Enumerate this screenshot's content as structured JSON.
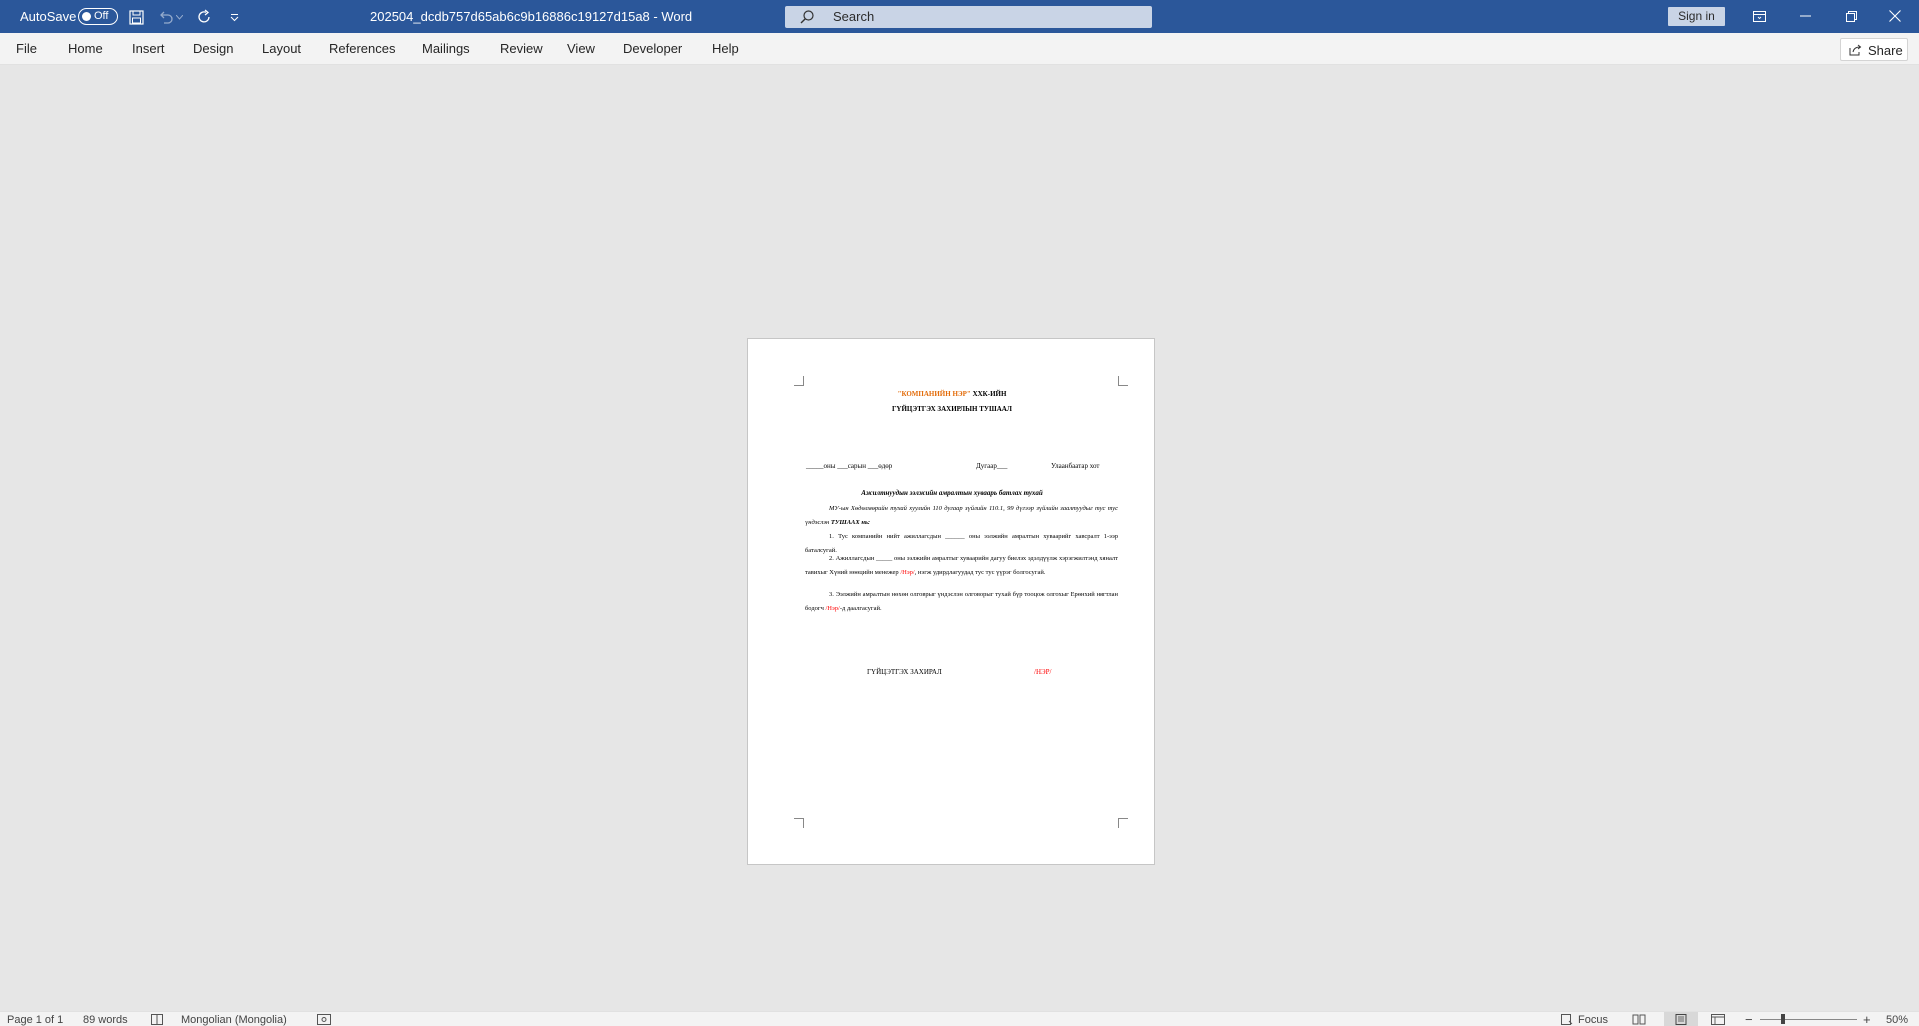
{
  "titlebar": {
    "autosave_label": "AutoSave",
    "autosave_state": "Off",
    "document_title": "202504_dcdb757d65ab6c9b16886c19127d15a8  -  Word",
    "search_placeholder": "Search",
    "signin_label": "Sign in"
  },
  "ribbon": {
    "tabs": [
      "File",
      "Home",
      "Insert",
      "Design",
      "Layout",
      "References",
      "Mailings",
      "Review",
      "View",
      "Developer",
      "Help"
    ],
    "share_label": "Share"
  },
  "document": {
    "header_company": "\"КОМПАНИЙН НЭР\"",
    "header_suffix": " ХХК-ИЙН",
    "header_line2": "ГҮЙЦЭТГЭХ ЗАХИРЛЫН ТУШААЛ",
    "date_line": "_____оны ___сарын ___өдөр",
    "number_line": "Дугаар___",
    "city_line": "Улаанбаатар хот",
    "subject": "Ажилтнуудын ээлжийн амралтын хуваарь батлах тухай",
    "preamble_a": "МУ-ын Хөдөлмөрийн тухай хуулийн 110 дугаар зүйлийн 110.1, 99 дүгээр зүйлийн заалтуудыг тус тус үндэслэн",
    "preamble_b": "ТУШААХ нь:",
    "item1": "1. Тус компанийн нийт ажиллагсдын ______ оны ээлжийн амралтын хуваарийг хавсралт 1-ээр баталсугай.",
    "item2_a": "2. Ажиллагсдын _____ оны ээлжийн амралтыг хуваарийн дагуу биелэх эдэлдүүлж хэрэгжилтэнд хяналт тавихыг Хүний нөөцийн менежер",
    "item2_name": "/Нэр/",
    "item2_b": ", нэгж удирдлагуудад тус тус үүрэг болгосугай.",
    "item3_a": "3. Ээлжийн амралтын нөхөн олговрыг үндэслэн олговорыг тухай бүр тооцож олгохыг Ерөнхий нягтлан бодогч",
    "item3_name": "/Нэр/",
    "item3_b": "-д даалгасугай.",
    "sign_title": "ГҮЙЦЭТГЭХ ЗАХИРАЛ",
    "sign_name": "/НЭР/"
  },
  "statusbar": {
    "page": "Page 1 of 1",
    "words": "89 words",
    "language": "Mongolian (Mongolia)",
    "focus": "Focus",
    "zoom": "50%"
  },
  "colors": {
    "titlebar": "#2b579a",
    "accent_orange": "#e36c0a",
    "accent_red": "#ff0000"
  }
}
